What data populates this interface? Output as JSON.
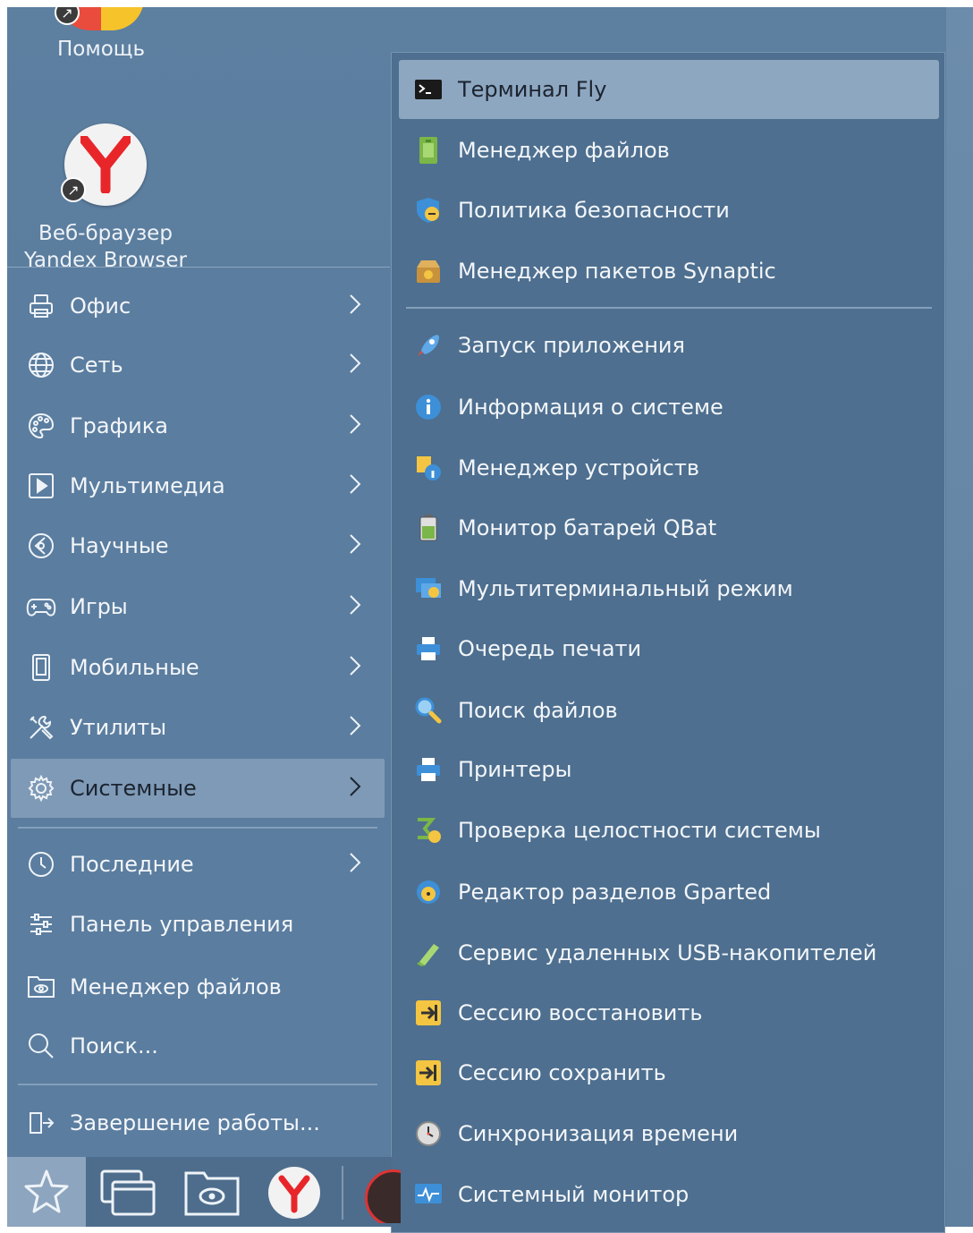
{
  "desktop": {
    "help_label": "Помощь",
    "browser_label_line1": "Веб-браузер",
    "browser_label_line2": "Yandex Browser"
  },
  "categories": [
    {
      "label": "Офис",
      "icon": "printer-icon",
      "has_submenu": true
    },
    {
      "label": "Сеть",
      "icon": "globe-icon",
      "has_submenu": true
    },
    {
      "label": "Графика",
      "icon": "palette-icon",
      "has_submenu": true
    },
    {
      "label": "Мультимедиа",
      "icon": "play-icon",
      "has_submenu": true
    },
    {
      "label": "Научные",
      "icon": "science-icon",
      "has_submenu": true
    },
    {
      "label": "Игры",
      "icon": "gamepad-icon",
      "has_submenu": true
    },
    {
      "label": "Мобильные",
      "icon": "phone-icon",
      "has_submenu": true
    },
    {
      "label": "Утилиты",
      "icon": "tools-icon",
      "has_submenu": true
    },
    {
      "label": "Системные",
      "icon": "gear-icon",
      "has_submenu": true,
      "active": true
    }
  ],
  "bottom_items": [
    {
      "label": "Последние",
      "icon": "clock-icon",
      "has_submenu": true
    },
    {
      "label": "Панель управления",
      "icon": "sliders-icon",
      "has_submenu": false
    },
    {
      "label": "Менеджер файлов",
      "icon": "folder-icon",
      "has_submenu": false
    },
    {
      "label": "Поиск...",
      "icon": "search-icon",
      "has_submenu": false
    }
  ],
  "shutdown_label": "Завершение работы...",
  "submenu": {
    "top_items": [
      {
        "label": "Терминал Fly",
        "icon": "terminal-icon",
        "highlighted": true
      },
      {
        "label": "Менеджер файлов",
        "icon": "file-manager-icon"
      },
      {
        "label": "Политика безопасности",
        "icon": "security-policy-icon"
      },
      {
        "label": "Менеджер пакетов Synaptic",
        "icon": "package-manager-icon"
      }
    ],
    "items": [
      {
        "label": "Запуск приложения",
        "icon": "rocket-icon"
      },
      {
        "label": "Информация о системе",
        "icon": "info-icon"
      },
      {
        "label": "Менеджер устройств",
        "icon": "device-manager-icon"
      },
      {
        "label": "Монитор батарей QBat",
        "icon": "battery-icon"
      },
      {
        "label": "Мультитерминальный режим",
        "icon": "multiterminal-icon"
      },
      {
        "label": "Очередь печати",
        "icon": "print-queue-icon"
      },
      {
        "label": "Поиск файлов",
        "icon": "file-search-icon"
      },
      {
        "label": "Принтеры",
        "icon": "printers-icon"
      },
      {
        "label": "Проверка целостности системы",
        "icon": "integrity-icon"
      },
      {
        "label": "Редактор разделов Gparted",
        "icon": "gparted-icon"
      },
      {
        "label": "Сервис удаленных USB-накопителей",
        "icon": "usb-icon"
      },
      {
        "label": "Сессию восстановить",
        "icon": "session-restore-icon"
      },
      {
        "label": "Сессию сохранить",
        "icon": "session-save-icon"
      },
      {
        "label": "Синхронизация времени",
        "icon": "time-sync-icon"
      },
      {
        "label": "Системный монитор",
        "icon": "system-monitor-icon"
      }
    ]
  },
  "taskbar": {
    "items": [
      "start-menu-icon",
      "windows-icon",
      "file-manager-icon",
      "yandex-browser-icon",
      "app-icon"
    ]
  },
  "colors": {
    "accent_highlight": "#8ea7c1",
    "menu_bg": "#4e6f8f",
    "panel_bg": "#5b7d9f"
  }
}
